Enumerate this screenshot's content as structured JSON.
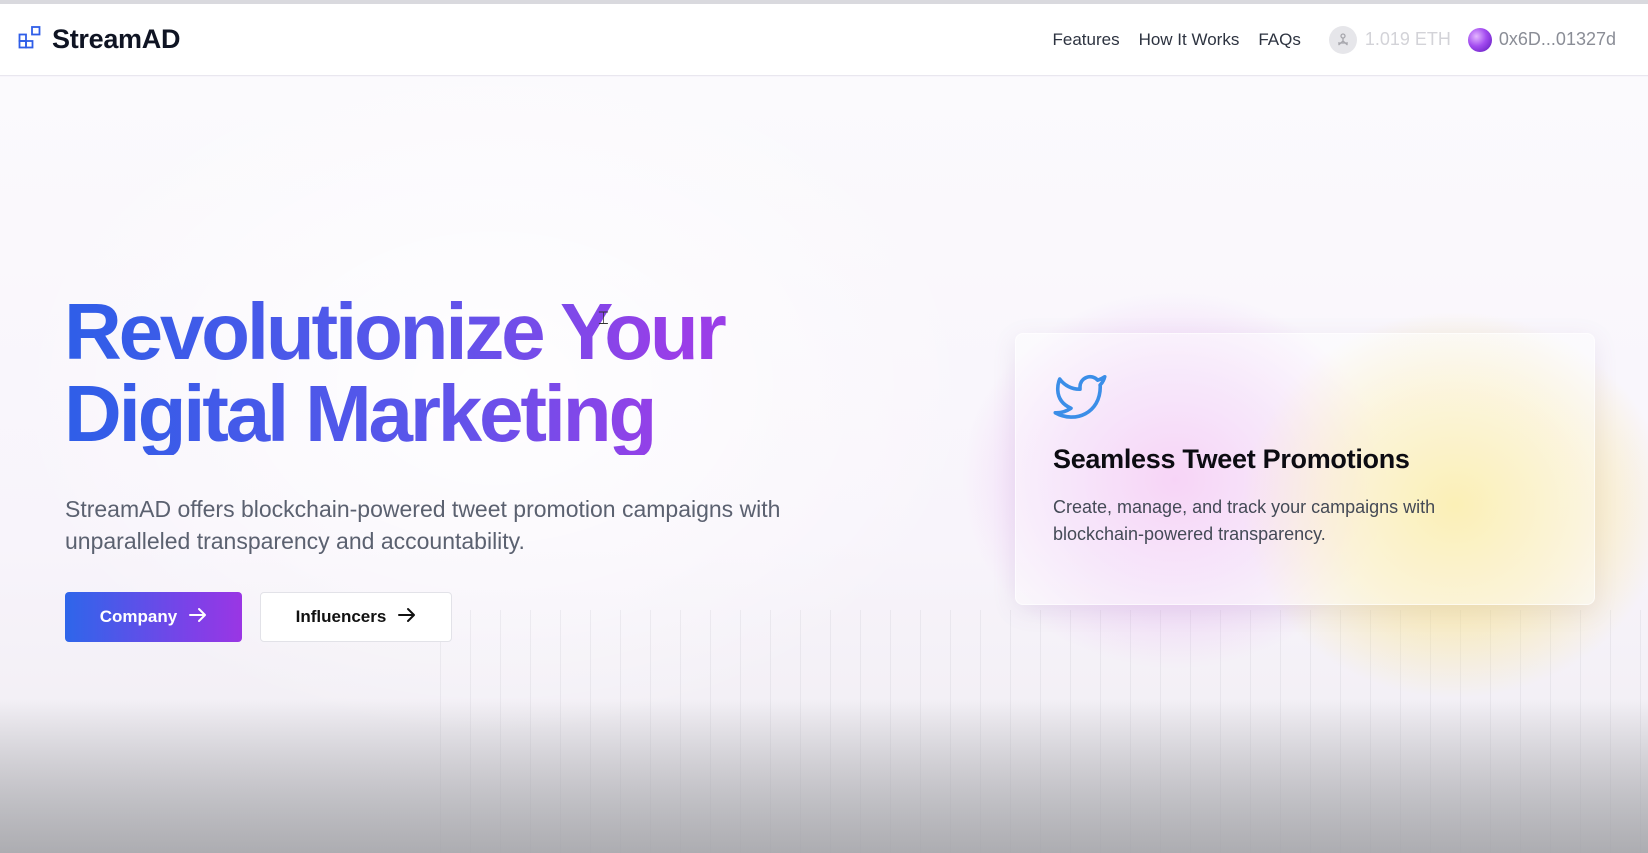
{
  "brand": {
    "name": "StreamAD",
    "icon": "grid-squares-icon",
    "accent": "#2f5ee8"
  },
  "nav": {
    "features": "Features",
    "how_it_works": "How It Works",
    "faqs": "FAQs"
  },
  "wallet": {
    "network_icon": "network-icon",
    "balance": "1.019 ETH",
    "address": "0x6D...01327d"
  },
  "hero": {
    "title_line1": "Revolutionize Your",
    "title_line2": "Digital Marketing",
    "subtitle": "StreamAD offers blockchain-powered tweet promotion campaigns with unparalleled transparency and accountability.",
    "company_button": "Company",
    "influencers_button": "Influencers",
    "gradient_start": "#2f5ee8",
    "gradient_end": "#9a3ee8"
  },
  "card": {
    "icon": "twitter-bird-icon",
    "title": "Seamless Tweet Promotions",
    "text": "Create, manage, and track your campaigns with blockchain-powered transparency."
  }
}
